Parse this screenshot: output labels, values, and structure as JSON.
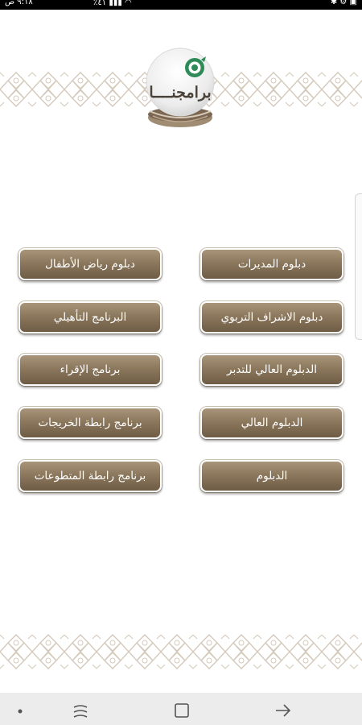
{
  "status_bar": {
    "time": "٩:١٨ ص",
    "battery": "٪٤١",
    "icons": [
      "notification-icon",
      "signal-icon",
      "wifi-icon",
      "bluetooth-icon"
    ]
  },
  "logo": {
    "title": "برامجنــــا"
  },
  "programs": {
    "right_column": [
      {
        "label": "دبلوم المديرات"
      },
      {
        "label": "دبلوم الاشراف التربوي"
      },
      {
        "label": "الدبلوم العالي للتدبر"
      },
      {
        "label": "الدبلوم العالي"
      },
      {
        "label": "الدبلوم"
      }
    ],
    "left_column": [
      {
        "label": "دبلوم رياض الأطفال"
      },
      {
        "label": "البرنامج التأهيلي"
      },
      {
        "label": "برنامج الإقراء"
      },
      {
        "label": "برنامج رابطة الخريجات"
      },
      {
        "label": "برنامج رابطة المتطوعات"
      }
    ]
  },
  "colors": {
    "button_top": "#a8957a",
    "button_bottom": "#6e5c45",
    "ornament": "#cfc3b4",
    "logo_green": "#2e8b57"
  },
  "nav_bar": {
    "items": [
      "dot-icon",
      "recent-apps-icon",
      "home-icon",
      "back-icon"
    ]
  }
}
